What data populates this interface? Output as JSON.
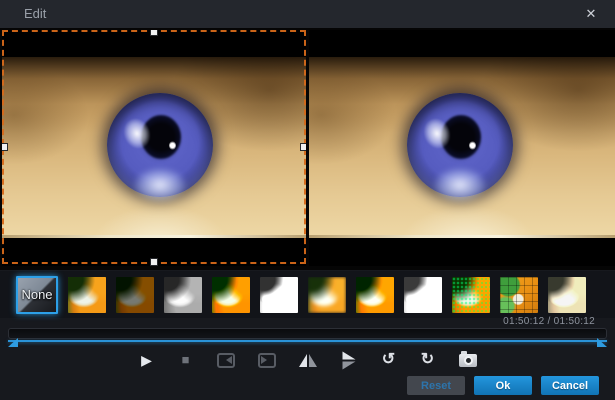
{
  "window": {
    "title": "Edit",
    "close_icon": "✕"
  },
  "preview": {
    "panels": [
      {
        "name": "before-preview",
        "selected": true
      },
      {
        "name": "after-preview",
        "selected": false
      }
    ],
    "selection_color": "#d66a1a"
  },
  "filters": {
    "none_label": "None",
    "selected": "none",
    "items": [
      {
        "name": "none"
      },
      {
        "name": "original"
      },
      {
        "name": "dark"
      },
      {
        "name": "grayscale"
      },
      {
        "name": "vivid"
      },
      {
        "name": "sketch"
      },
      {
        "name": "blur"
      },
      {
        "name": "enhance"
      },
      {
        "name": "emboss"
      },
      {
        "name": "noise"
      },
      {
        "name": "mosaic"
      },
      {
        "name": "sepia"
      }
    ]
  },
  "timeline": {
    "time_display": "01:50:12 / 01:50:12",
    "accent": "#2a93d8"
  },
  "controls": {
    "items": [
      {
        "name": "play",
        "glyph": "▶",
        "enabled": true
      },
      {
        "name": "stop",
        "glyph": "■",
        "enabled": false
      },
      {
        "name": "trim-start",
        "enabled": false
      },
      {
        "name": "trim-end",
        "enabled": false
      },
      {
        "name": "flip-horizontal",
        "enabled": true
      },
      {
        "name": "flip-vertical",
        "enabled": true
      },
      {
        "name": "rotate-left",
        "glyph": "↺",
        "enabled": true
      },
      {
        "name": "rotate-right",
        "glyph": "↻",
        "enabled": true
      },
      {
        "name": "snapshot",
        "enabled": true
      }
    ]
  },
  "buttons": {
    "reset": "Reset",
    "ok": "Ok",
    "cancel": "Cancel"
  },
  "colors": {
    "accent_blue": "#1e8fd5",
    "titlebar": "#24272d",
    "background": "#17191e"
  }
}
